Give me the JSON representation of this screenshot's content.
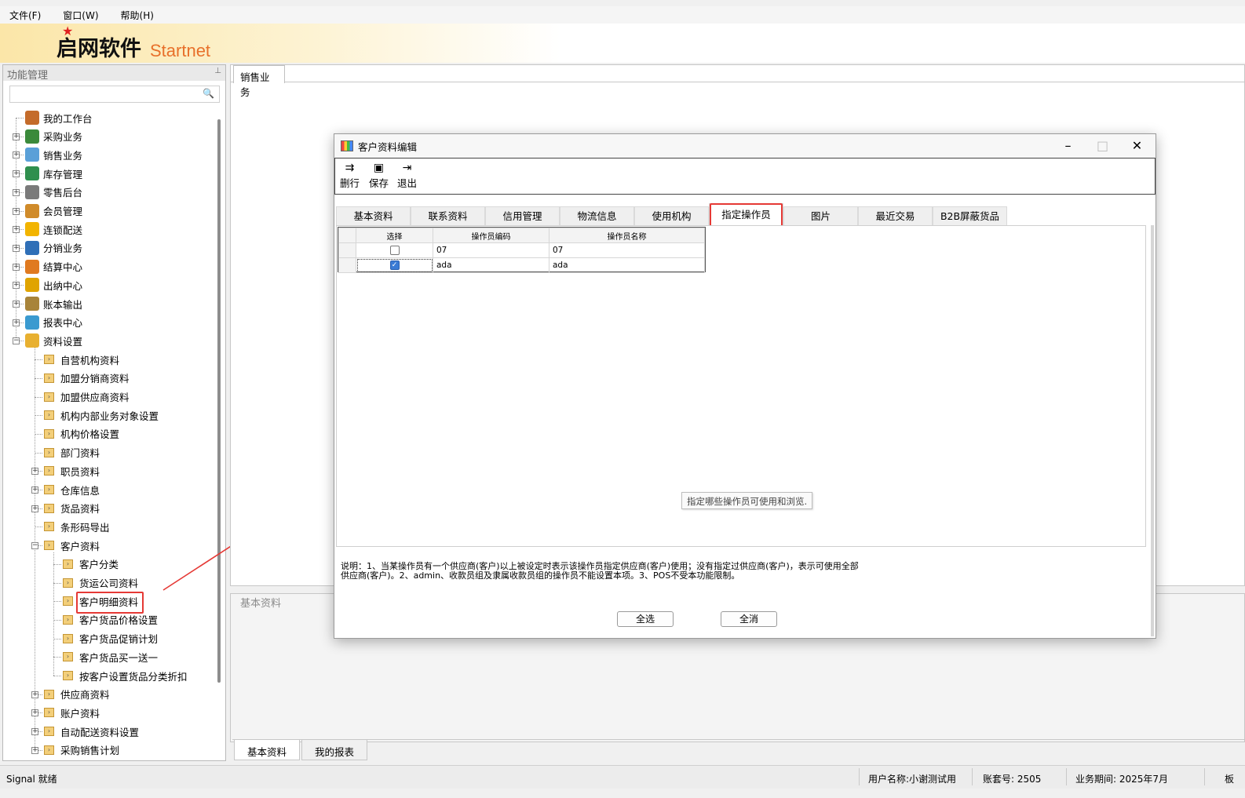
{
  "menu": {
    "items": [
      "文件(F)",
      "窗口(W)",
      "帮助(H)"
    ]
  },
  "logo": {
    "cn": "启网软件",
    "en": "Startnet"
  },
  "left_panel": {
    "title": "功能管理",
    "pin_icon": "pin-icon",
    "search_placeholder": "",
    "tree": [
      {
        "label": "我的工作台",
        "level": 0,
        "expander": ""
      },
      {
        "label": "采购业务",
        "level": 0,
        "expander": "+"
      },
      {
        "label": "销售业务",
        "level": 0,
        "expander": "+"
      },
      {
        "label": "库存管理",
        "level": 0,
        "expander": "+"
      },
      {
        "label": "零售后台",
        "level": 0,
        "expander": "+"
      },
      {
        "label": "会员管理",
        "level": 0,
        "expander": "+"
      },
      {
        "label": "连锁配送",
        "level": 0,
        "expander": "+"
      },
      {
        "label": "分销业务",
        "level": 0,
        "expander": "+"
      },
      {
        "label": "结算中心",
        "level": 0,
        "expander": "+"
      },
      {
        "label": "出纳中心",
        "level": 0,
        "expander": "+"
      },
      {
        "label": "账本输出",
        "level": 0,
        "expander": "+"
      },
      {
        "label": "报表中心",
        "level": 0,
        "expander": "+"
      },
      {
        "label": "资料设置",
        "level": 0,
        "expander": "-"
      },
      {
        "label": "自营机构资料",
        "level": 1,
        "expander": ""
      },
      {
        "label": "加盟分销商资料",
        "level": 1,
        "expander": ""
      },
      {
        "label": "加盟供应商资料",
        "level": 1,
        "expander": ""
      },
      {
        "label": "机构内部业务对象设置",
        "level": 1,
        "expander": ""
      },
      {
        "label": "机构价格设置",
        "level": 1,
        "expander": ""
      },
      {
        "label": "部门资料",
        "level": 1,
        "expander": ""
      },
      {
        "label": "职员资料",
        "level": 1,
        "expander": "+"
      },
      {
        "label": "仓库信息",
        "level": 1,
        "expander": "+"
      },
      {
        "label": "货品资料",
        "level": 1,
        "expander": "+"
      },
      {
        "label": "条形码导出",
        "level": 1,
        "expander": ""
      },
      {
        "label": "客户资料",
        "level": 1,
        "expander": "-"
      },
      {
        "label": "客户分类",
        "level": 2,
        "expander": ""
      },
      {
        "label": "货运公司资料",
        "level": 2,
        "expander": ""
      },
      {
        "label": "客户明细资料",
        "level": 2,
        "expander": ""
      },
      {
        "label": "客户货品价格设置",
        "level": 2,
        "expander": ""
      },
      {
        "label": "客户货品促销计划",
        "level": 2,
        "expander": ""
      },
      {
        "label": "客户货品买一送一",
        "level": 2,
        "expander": ""
      },
      {
        "label": "按客户设置货品分类折扣",
        "level": 2,
        "expander": ""
      },
      {
        "label": "供应商资料",
        "level": 1,
        "expander": "+"
      },
      {
        "label": "账户资料",
        "level": 1,
        "expander": "+"
      },
      {
        "label": "自动配送资料设置",
        "level": 1,
        "expander": "+"
      },
      {
        "label": "采购销售计划",
        "level": 1,
        "expander": "+"
      }
    ]
  },
  "main": {
    "tab": "销售业务",
    "bottom_panel_title": "基本资料",
    "bottom_tabs": [
      "基本资料",
      "我的报表"
    ]
  },
  "dialog": {
    "title": "客户资料编辑",
    "toolbar": [
      {
        "label": "删行",
        "icon": "delete-row-icon"
      },
      {
        "label": "保存",
        "icon": "save-icon"
      },
      {
        "label": "退出",
        "icon": "exit-icon"
      }
    ],
    "tabs": [
      "基本资料",
      "联系资料",
      "信用管理",
      "物流信息",
      "使用机构",
      "指定操作员",
      "图片",
      "最近交易",
      "B2B屏蔽货品"
    ],
    "active_tab": "指定操作员",
    "grid": {
      "columns": [
        "选择",
        "操作员编码",
        "操作员名称"
      ],
      "rows": [
        {
          "checked": false,
          "code": "07",
          "name": "07"
        },
        {
          "checked": true,
          "code": "ada",
          "name": "ada"
        }
      ]
    },
    "hint": "指定哪些操作员可使用和浏览.",
    "notes_line1": "说明：1、当某操作员有一个供应商(客户)以上被设定时表示该操作员指定供应商(客户)使用；没有指定过供应商(客户)，表示可使用全部",
    "notes_line2": "供应商(客户)。2、admin、收款员组及隶属收款员组的操作员不能设置本项。3、POS不受本功能限制。",
    "buttons": {
      "select_all": "全选",
      "deselect_all": "全消"
    }
  },
  "status": {
    "left": "Signal 就绪",
    "user": "用户名称:小谢测试用",
    "account": "账套号: 2505",
    "period": "业务期间: 2025年7月",
    "extra": "板"
  },
  "colors": {
    "highlight": "#e53935",
    "logo_en": "#e8702a",
    "check_on": "#3a7bd5"
  }
}
